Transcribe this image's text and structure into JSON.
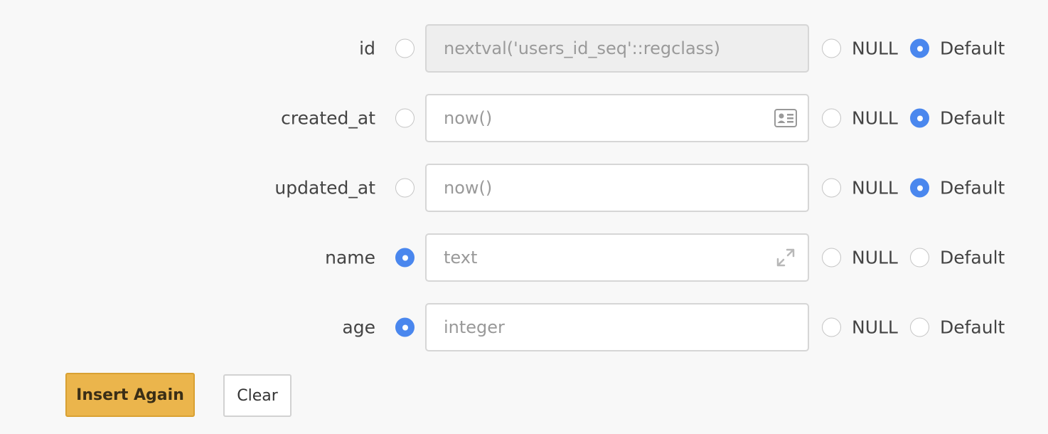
{
  "fields": [
    {
      "name": "id",
      "placeholder": "nextval('users_id_seq'::regclass)",
      "value_selected": false,
      "null_selected": false,
      "default_selected": true,
      "disabled": true,
      "icon": ""
    },
    {
      "name": "created_at",
      "placeholder": "now()",
      "value_selected": false,
      "null_selected": false,
      "default_selected": true,
      "disabled": false,
      "icon": "id-card-icon"
    },
    {
      "name": "updated_at",
      "placeholder": "now()",
      "value_selected": false,
      "null_selected": false,
      "default_selected": true,
      "disabled": false,
      "icon": ""
    },
    {
      "name": "name",
      "placeholder": "text",
      "value_selected": true,
      "null_selected": false,
      "default_selected": false,
      "disabled": false,
      "icon": "expand-icon"
    },
    {
      "name": "age",
      "placeholder": "integer",
      "value_selected": true,
      "null_selected": false,
      "default_selected": false,
      "disabled": false,
      "icon": ""
    }
  ],
  "options": {
    "null_label": "NULL",
    "default_label": "Default"
  },
  "buttons": {
    "insert_again_label": "Insert Again",
    "clear_label": "Clear"
  },
  "colors": {
    "accent": "#4a87ee",
    "primary_button": "#ebb54c",
    "page_background": "#f8f8f8"
  }
}
